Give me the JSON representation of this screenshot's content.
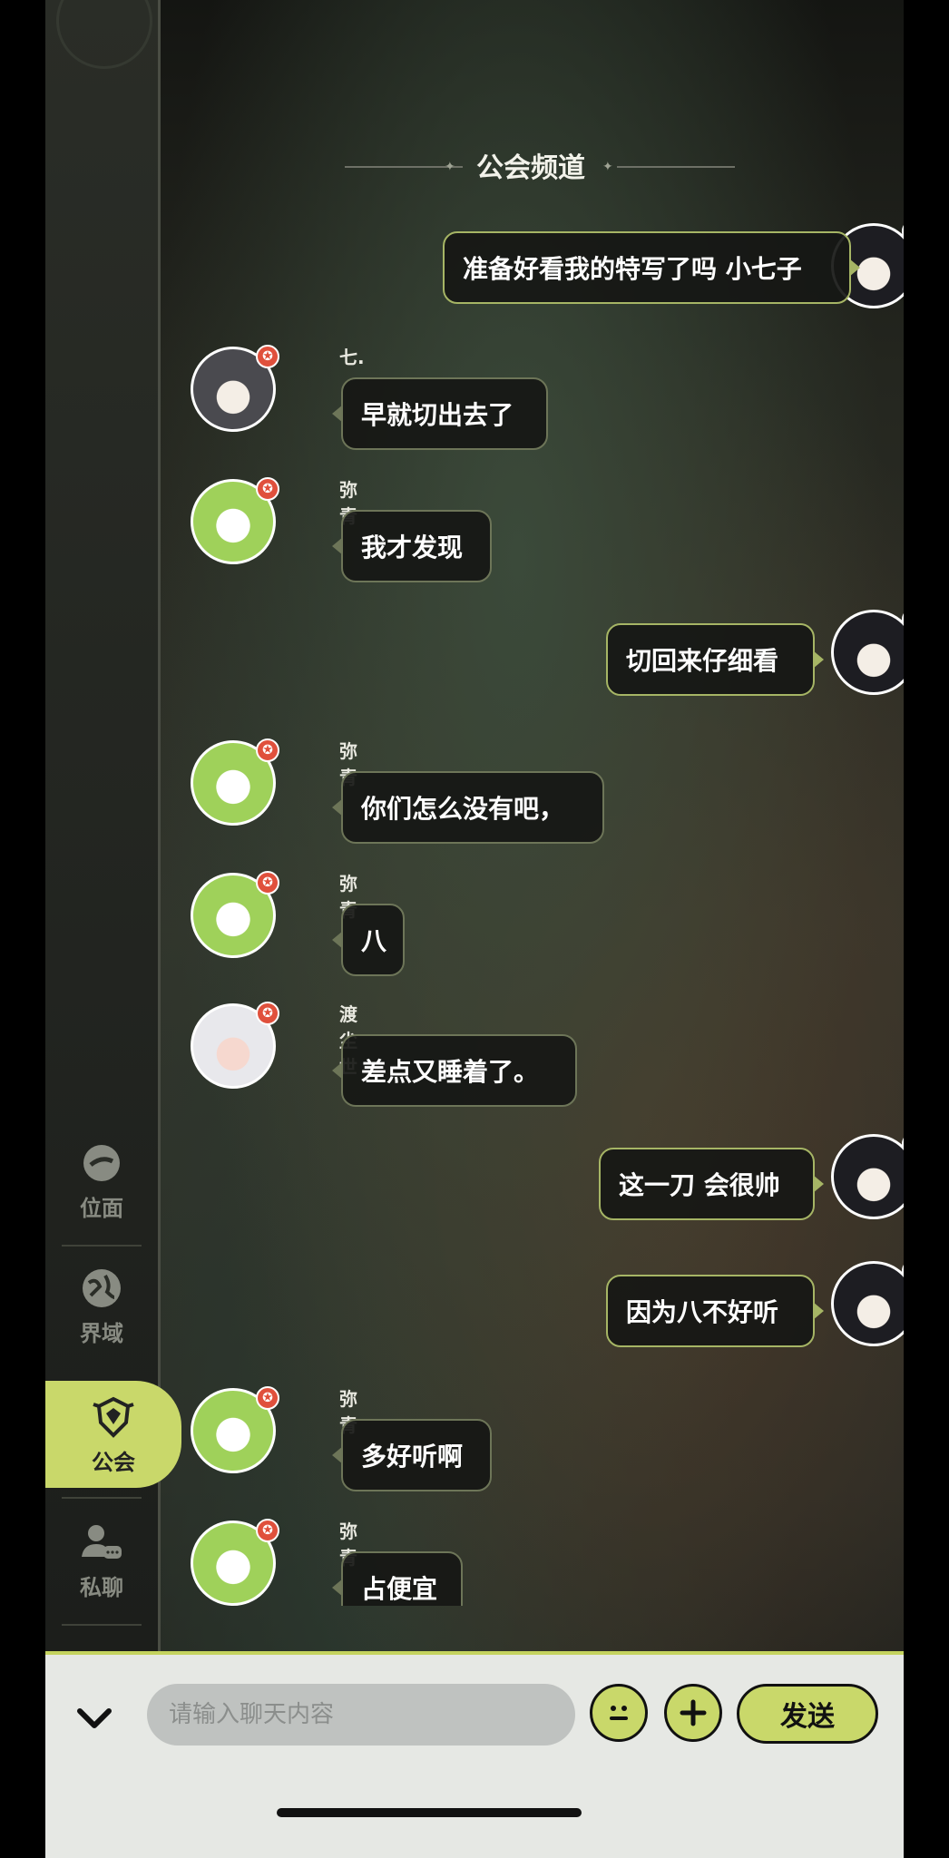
{
  "channel_title": "公会频道",
  "sidebar": {
    "items": [
      {
        "label": "位面",
        "icon": "planet-coin-icon"
      },
      {
        "label": "界域",
        "icon": "globe-icon"
      },
      {
        "label": "公会",
        "icon": "guild-crest-icon",
        "active": true
      },
      {
        "label": "私聊",
        "icon": "private-chat-icon"
      }
    ]
  },
  "messages": [
    {
      "side": "right",
      "name": "",
      "text": "准备好看我的特写了吗 小七子",
      "avatar": "dark"
    },
    {
      "side": "left",
      "name": "七.",
      "text": "早就切出去了",
      "avatar": "gray"
    },
    {
      "side": "left",
      "name": "弥青",
      "text": "我才发现",
      "avatar": "green"
    },
    {
      "side": "right",
      "name": "",
      "text": "切回来仔细看",
      "avatar": "dark"
    },
    {
      "side": "left",
      "name": "弥青",
      "text": "你们怎么没有吧，",
      "avatar": "green"
    },
    {
      "side": "left",
      "name": "弥青",
      "text": "八",
      "avatar": "green"
    },
    {
      "side": "left",
      "name": "渡尘世",
      "text": "差点又睡着了。",
      "avatar": "white"
    },
    {
      "side": "right",
      "name": "",
      "text": "这一刀 会很帅",
      "avatar": "dark"
    },
    {
      "side": "right",
      "name": "",
      "text": "因为八不好听",
      "avatar": "dark"
    },
    {
      "side": "left",
      "name": "弥青",
      "text": "多好听啊",
      "avatar": "green"
    },
    {
      "side": "left",
      "name": "弥青",
      "text": "占便宜",
      "avatar": "green"
    }
  ],
  "input": {
    "placeholder": "请输入聊天内容",
    "send_label": "发送"
  },
  "colors": {
    "accent": "#c9d86a",
    "bubble_border": "#6d7558",
    "badge_red": "#e0503c",
    "badge_orange": "#f08a2c"
  }
}
